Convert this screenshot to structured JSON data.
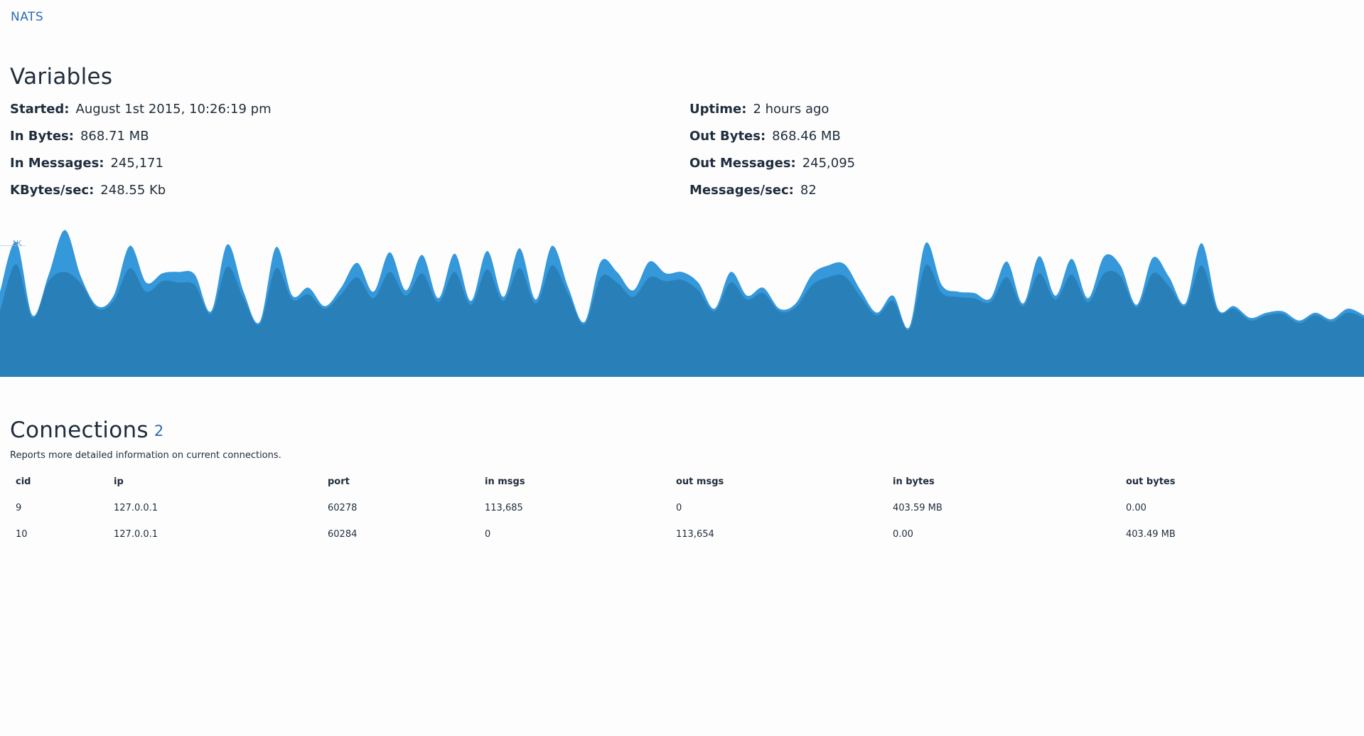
{
  "nav": {
    "brand": "NATS"
  },
  "variables": {
    "title": "Variables",
    "stats": [
      {
        "label": "Started:",
        "value": "August 1st 2015, 10:26:19 pm",
        "key": "started"
      },
      {
        "label": "Uptime:",
        "value": "2 hours ago",
        "key": "uptime"
      },
      {
        "label": "In Bytes:",
        "value": "868.71 MB",
        "key": "in-bytes"
      },
      {
        "label": "Out Bytes:",
        "value": "868.46 MB",
        "key": "out-bytes"
      },
      {
        "label": "In Messages:",
        "value": "245,171",
        "key": "in-messages"
      },
      {
        "label": "Out Messages:",
        "value": "245,095",
        "key": "out-messages"
      },
      {
        "label": "KBytes/sec:",
        "value": "248.55 Kb",
        "key": "kbytes-sec"
      },
      {
        "label": "Messages/sec:",
        "value": "82",
        "key": "messages-sec"
      }
    ]
  },
  "chart_data": {
    "type": "area",
    "y_tick_label": "1K",
    "colors": {
      "outer": "#3498db",
      "inner": "#2980b9"
    },
    "series": [
      {
        "values": [
          650,
          1030,
          470,
          780,
          1120,
          760,
          540,
          620,
          1000,
          720,
          790,
          800,
          780,
          500,
          1010,
          650,
          420,
          990,
          620,
          680,
          540,
          680,
          870,
          650,
          950,
          660,
          930,
          600,
          940,
          580,
          960,
          610,
          980,
          590,
          1000,
          680,
          420,
          880,
          800,
          660,
          880,
          790,
          800,
          720,
          520,
          800,
          620,
          680,
          520,
          560,
          780,
          850,
          860,
          660,
          490,
          620,
          380,
          1020,
          700,
          650,
          640,
          600,
          880,
          560,
          920,
          620,
          900,
          600,
          920,
          850,
          550,
          910,
          760,
          560,
          1020,
          520,
          540,
          450,
          490,
          500,
          430,
          490,
          440,
          520,
          470
        ]
      },
      {
        "values": [
          500,
          860,
          450,
          730,
          800,
          710,
          520,
          580,
          830,
          650,
          730,
          720,
          700,
          480,
          840,
          600,
          400,
          830,
          590,
          630,
          520,
          630,
          760,
          600,
          800,
          620,
          790,
          570,
          800,
          550,
          820,
          580,
          830,
          560,
          850,
          630,
          400,
          760,
          720,
          610,
          760,
          730,
          740,
          660,
          500,
          720,
          590,
          640,
          500,
          530,
          700,
          760,
          770,
          610,
          470,
          580,
          360,
          850,
          640,
          610,
          600,
          570,
          760,
          540,
          790,
          590,
          780,
          570,
          790,
          770,
          530,
          790,
          690,
          540,
          850,
          500,
          520,
          430,
          470,
          480,
          410,
          470,
          420,
          490,
          450
        ]
      }
    ],
    "ylim": [
      0,
      1150
    ]
  },
  "connections": {
    "title": "Connections",
    "count": "2",
    "subtitle": "Reports more detailed information on current connections.",
    "columns": [
      "cid",
      "ip",
      "port",
      "in msgs",
      "out msgs",
      "in bytes",
      "out bytes"
    ],
    "rows": [
      [
        "9",
        "127.0.0.1",
        "60278",
        "113,685",
        "0",
        "403.59 MB",
        "0.00"
      ],
      [
        "10",
        "127.0.0.1",
        "60284",
        "0",
        "113,654",
        "0.00",
        "403.49 MB"
      ]
    ]
  }
}
